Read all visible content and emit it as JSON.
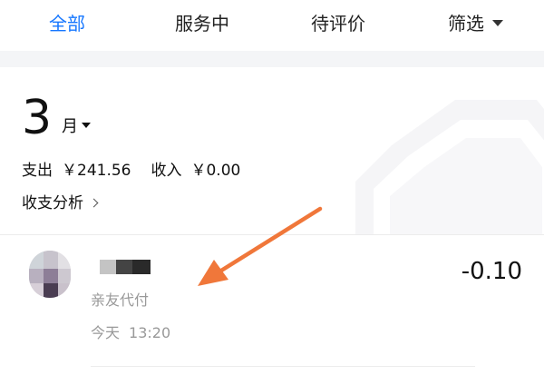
{
  "tabs": [
    {
      "label": "全部",
      "active": true
    },
    {
      "label": "服务中",
      "active": false
    },
    {
      "label": "待评价",
      "active": false
    },
    {
      "label": "筛选",
      "active": false
    }
  ],
  "summary": {
    "month": "3",
    "month_unit": "月",
    "expense_label": "支出",
    "expense_value": "￥241.56",
    "income_label": "收入",
    "income_value": "￥0.00",
    "analysis_label": "收支分析"
  },
  "transactions": [
    {
      "name": "",
      "type": "亲友代付",
      "day": "今天",
      "time": "13:20",
      "amount": "-0.10"
    }
  ],
  "colors": {
    "accent": "#1677ff",
    "annotation_arrow": "#f0773a",
    "muted_text": "#999999"
  },
  "icons": {
    "filter_dropdown": "caret-down-icon",
    "month_dropdown": "caret-down-icon",
    "analysis_arrow": "chevron-right-icon"
  }
}
